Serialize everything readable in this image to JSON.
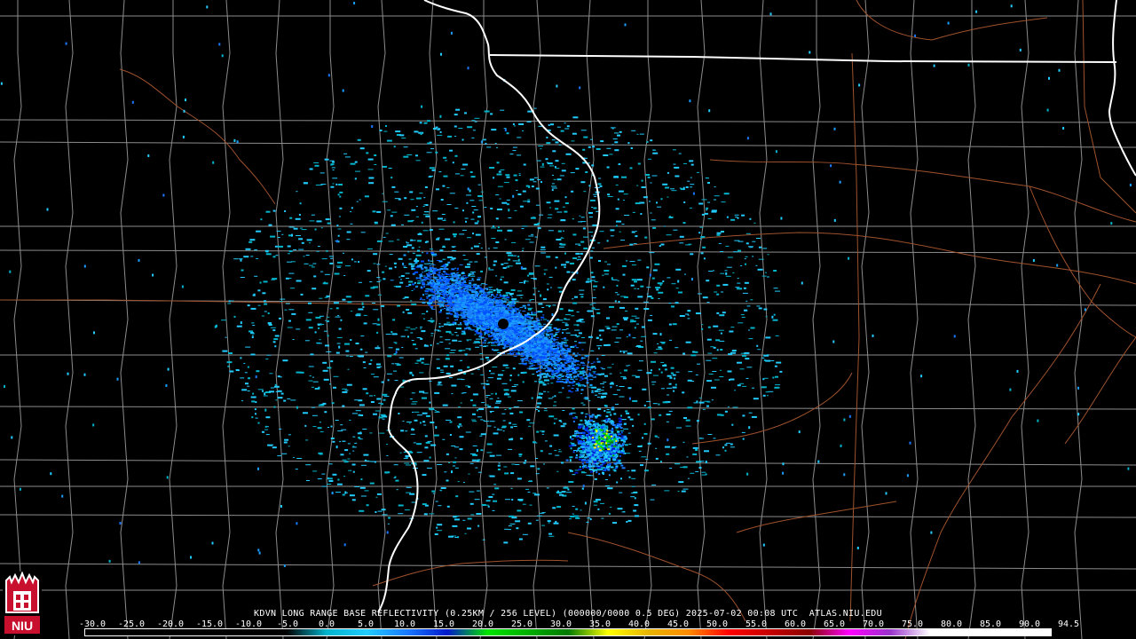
{
  "header": {
    "product_line": "KDVN LONG RANGE BASE REFLECTIVITY (0.25KM / 256 LEVEL) (000000/0000 0.5 DEG) 2025-07-02 00:08 UTC  ATLAS.NIU.EDU"
  },
  "logo": {
    "text": "NIU",
    "color": "#c8102e"
  },
  "scale": {
    "labels": [
      "-30.0",
      "-25.0",
      "-20.0",
      "-15.0",
      "-10.0",
      "-5.0",
      "0.0",
      "5.0",
      "10.0",
      "15.0",
      "20.0",
      "25.0",
      "30.0",
      "35.0",
      "40.0",
      "45.0",
      "50.0",
      "55.0",
      "60.0",
      "65.0",
      "70.0",
      "75.0",
      "80.0",
      "85.0",
      "90.0",
      "94.5"
    ],
    "colors": [
      "#000000",
      "#000000",
      "#000000",
      "#000000",
      "#000000",
      "#000000",
      "#00b4cc",
      "#22ccff",
      "#1a7aff",
      "#0018cc",
      "#00e400",
      "#00b000",
      "#007a00",
      "#ffff00",
      "#e6b400",
      "#ff8c00",
      "#ff0000",
      "#c80000",
      "#8b0000",
      "#ff00ff",
      "#9932cc",
      "#ffffff",
      "#ffffff",
      "#ffffff",
      "#ffffff"
    ]
  },
  "map": {
    "background": "#000000",
    "county_line_color": "#8c8c8c",
    "state_line_color": "#ffffff",
    "road_color": "#a0522d",
    "radar_site": "KDVN"
  }
}
